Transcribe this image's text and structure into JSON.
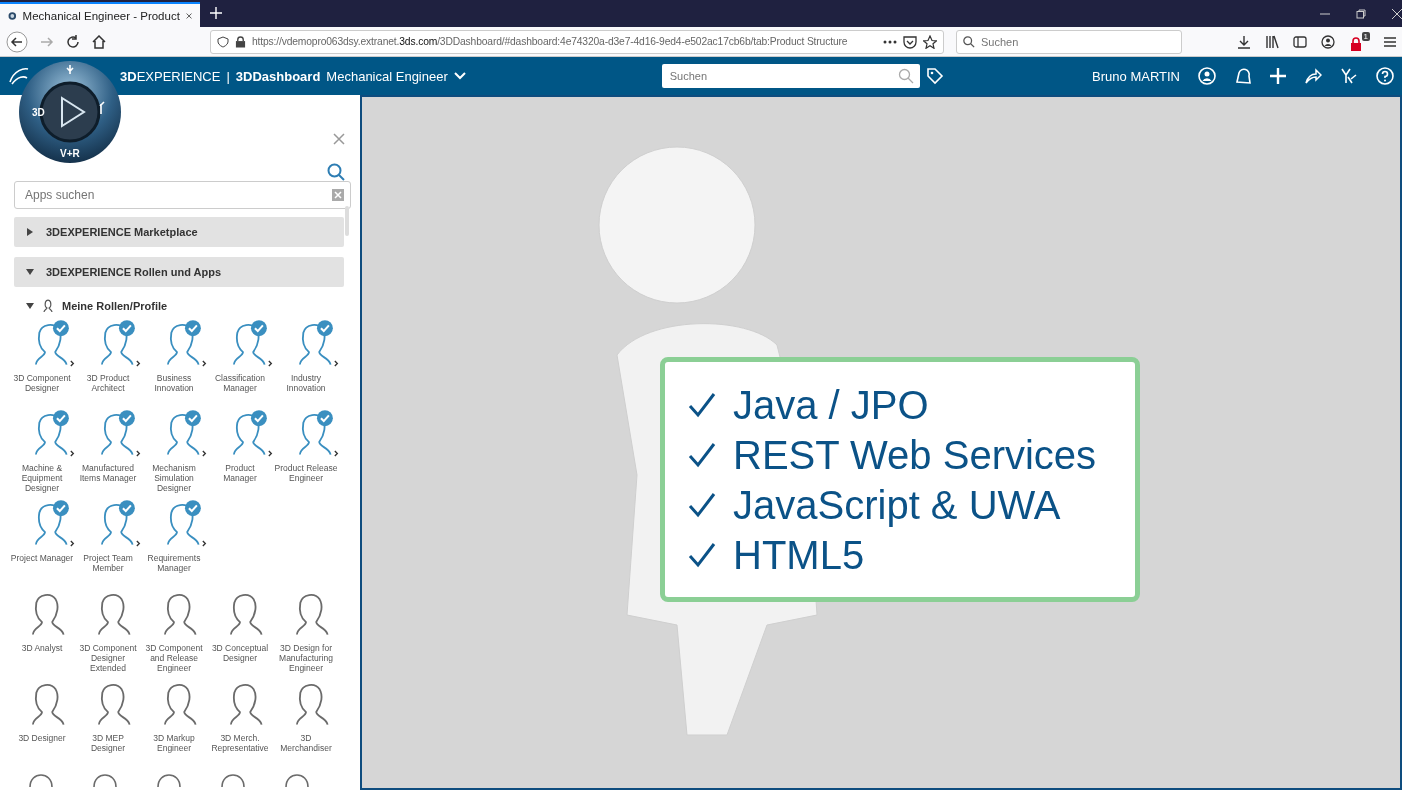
{
  "browser": {
    "tab": {
      "title": "Mechanical Engineer - Product"
    },
    "url": "https://vdemopro063dsy.extranet.**3ds.com**/3DDashboard/#dashboard:4e74320a-d3e7-4d16-9ed4-e502ac17cb6b/tab:Product Structure",
    "search": {
      "placeholder": "Suchen"
    },
    "notification_count": "1"
  },
  "app_bar": {
    "brand": "**3D**EXPERIENCE",
    "separator": "|",
    "app": "3DDashboard",
    "dashboard": "Mechanical Engineer",
    "search": {
      "placeholder": "Suchen"
    },
    "user": "Bruno MARTIN"
  },
  "compass": {
    "top_left": "3D",
    "bottom": "V+R"
  },
  "panel": {
    "search": {
      "placeholder": "Apps suchen"
    },
    "sections": [
      {
        "label": "3DEXPERIENCE Marketplace",
        "expanded": false
      },
      {
        "label": "3DEXPERIENCE Rollen und Apps",
        "expanded": true
      }
    ],
    "subsection": {
      "label": "Meine Rollen/Profile",
      "expanded": true
    },
    "roles": [
      {
        "label": "3D Component Designer",
        "assigned": true
      },
      {
        "label": "3D Product Architect",
        "assigned": true
      },
      {
        "label": "Business Innovation",
        "assigned": true
      },
      {
        "label": "Classification Manager",
        "assigned": true
      },
      {
        "label": "Industry Innovation",
        "assigned": true
      },
      {
        "label": "Machine & Equipment Designer",
        "assigned": true
      },
      {
        "label": "Manufactured Items Manager",
        "assigned": true
      },
      {
        "label": "Mechanism Simulation Designer",
        "assigned": true
      },
      {
        "label": "Product Manager",
        "assigned": true
      },
      {
        "label": "Product Release Engineer",
        "assigned": true
      },
      {
        "label": "Project Manager",
        "assigned": true
      },
      {
        "label": "Project Team Member",
        "assigned": true
      },
      {
        "label": "Requirements Manager",
        "assigned": true
      },
      {
        "label": "3D Analyst",
        "assigned": false
      },
      {
        "label": "3D Component Designer Extended",
        "assigned": false
      },
      {
        "label": "3D Component and Release Engineer",
        "assigned": false
      },
      {
        "label": "3D Conceptual Designer",
        "assigned": false
      },
      {
        "label": "3D Design for Manufacturing Engineer",
        "assigned": false
      },
      {
        "label": "3D Designer",
        "assigned": false
      },
      {
        "label": "3D MEP Designer",
        "assigned": false
      },
      {
        "label": "3D Markup Engineer",
        "assigned": false
      },
      {
        "label": "3D Merch. Representative",
        "assigned": false
      },
      {
        "label": "3D Merchandiser",
        "assigned": false
      }
    ]
  },
  "sign": {
    "items": [
      "Java / JPO",
      "REST Web Services",
      "JavaScript & UWA",
      "HTML5"
    ]
  }
}
